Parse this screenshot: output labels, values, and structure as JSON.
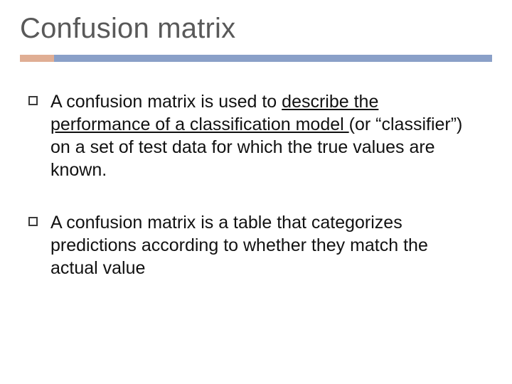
{
  "slide": {
    "title": "Confusion matrix",
    "bullets": [
      {
        "pre": "A confusion matrix is used to ",
        "u1": "describe the",
        "mid1": " ",
        "u2": "performance of a classification model ",
        "post": "(or “classifier”) on a set of test data for which the true values are known."
      },
      {
        "pre": "A confusion matrix is a table that categorizes predictions according to whether they match the actual value",
        "u1": "",
        "mid1": "",
        "u2": "",
        "post": ""
      }
    ]
  }
}
